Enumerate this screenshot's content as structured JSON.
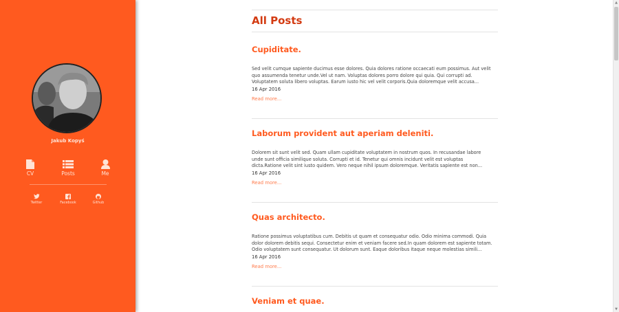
{
  "sidebar": {
    "author_name": "Jakub Kopyś",
    "nav": [
      {
        "label": "CV",
        "icon": "file-icon"
      },
      {
        "label": "Posts",
        "icon": "list-icon"
      },
      {
        "label": "Me",
        "icon": "user-icon"
      }
    ],
    "social": [
      {
        "label": "Twitter",
        "icon": "twitter-icon"
      },
      {
        "label": "Facebook",
        "icon": "facebook-icon"
      },
      {
        "label": "Github",
        "icon": "github-icon"
      }
    ]
  },
  "main": {
    "title": "All Posts",
    "read_more": "Read more...",
    "posts": [
      {
        "title": "Cupiditate.",
        "excerpt": "Sed velit cumque sapiente ducimus esse dolores. Quia dolores ratione occaecati eum possimus. Aut velit\nquo assumenda tenetur unde.Vel ut nam. Voluptas dolores porro dolore qui quia. Qui corrupti ad.\nVoluptatem soluta libero voluptas. Earum iusto hic vel velit corporis.Quia doloremque velit accusa...",
        "date": "16 Apr 2016"
      },
      {
        "title": "Laborum provident aut aperiam deleniti.",
        "excerpt": "Dolorem sit sunt velit sed. Quam ullam cupiditate voluptatem in nostrum quos. In recusandae labore\nunde sunt officia similique soluta. Corrupti et id. Tenetur qui omnis incidunt velit est voluptas\ndicta.Ratione velit sint iusto quidem. Vero neque nihil ipsum doloremque. Veritatis sapiente est non...",
        "date": "16 Apr 2016"
      },
      {
        "title": "Quas architecto.",
        "excerpt": "Ratione possimus voluptatibus cum. Debitis ut quam et consequatur odio. Odio minima commodi. Quia\ndolor dolorem debitis sequi. Consectetur enim et veniam facere sed.In quam dolorem est sapiente totam.\nOdio voluptatem sunt consequatur. Ut dolorum sunt. Eaque doloribus itaque neque molestias simili...",
        "date": "16 Apr 2016"
      },
      {
        "title": "Veniam et quae.",
        "excerpt": "",
        "date": ""
      }
    ]
  },
  "colors": {
    "accent": "#ff5a1f",
    "title": "#d33b12"
  }
}
